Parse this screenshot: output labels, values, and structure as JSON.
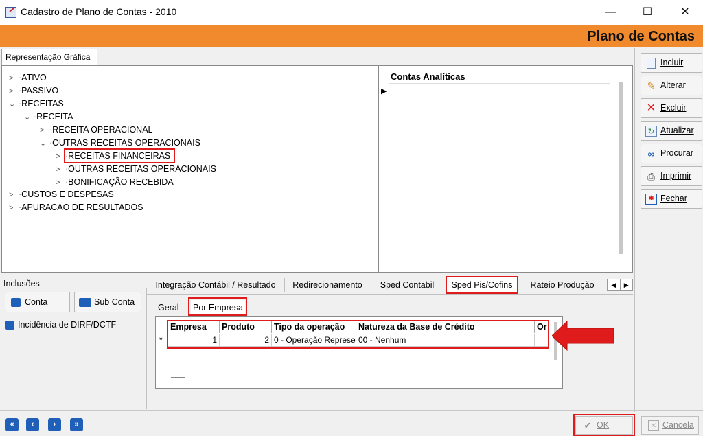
{
  "window": {
    "title": "Cadastro de Plano de Contas - 2010",
    "minimize": "—",
    "maximize": "☐",
    "close": "✕"
  },
  "header": {
    "title": "Plano de Contas"
  },
  "left_tab": {
    "label": "Representação Gráfica"
  },
  "tree": [
    {
      "label": "ATIVO",
      "expanded": false
    },
    {
      "label": "PASSIVO",
      "expanded": false
    },
    {
      "label": "RECEITAS",
      "expanded": true
    },
    {
      "label": "RECEITA",
      "expanded": true
    },
    {
      "label": "RECEITA OPERACIONAL",
      "expanded": false
    },
    {
      "label": "OUTRAS RECEITAS OPERACIONAIS",
      "expanded": true
    },
    {
      "label": "RECEITAS FINANCEIRAS",
      "expanded": false,
      "selected": true
    },
    {
      "label": "OUTRAS RECEITAS OPERACIONAIS",
      "expanded": false
    },
    {
      "label": "BONIFICAÇÃO RECEBIDA",
      "expanded": false
    },
    {
      "label": "CUSTOS E DESPESAS",
      "expanded": false
    },
    {
      "label": "APURACAO DE RESULTADOS",
      "expanded": false
    }
  ],
  "analytic": {
    "header": "Contas Analíticas",
    "row_indicator": "▶"
  },
  "toolbar": {
    "incluir": "Incluir",
    "alterar": "Alterar",
    "excluir": "Excluir",
    "atualizar": "Atualizar",
    "procurar": "Procurar",
    "imprimir": "Imprimir",
    "fechar": "Fechar"
  },
  "inclusoes": {
    "label": "Inclusões",
    "conta": "Conta",
    "sub_conta": "Sub Conta",
    "dirf": "Incidência de DIRF/DCTF"
  },
  "tabs": [
    "Integração Contábil / Resultado",
    "Redirecionamento",
    "Sped Contabil",
    "Sped Pis/Cofins",
    "Rateio Produção"
  ],
  "tab_nav": {
    "prev": "◀",
    "next": "▶"
  },
  "subtabs": [
    "Geral",
    "Por Empresa"
  ],
  "grid": {
    "columns": [
      "Empresa",
      "Produto",
      "Tipo da operação",
      "Natureza da Base de Crédito",
      "Or"
    ],
    "row_marker": "*",
    "rows": [
      [
        "1",
        "2",
        "0 - Operação Represen",
        "00 - Nenhum",
        ""
      ]
    ]
  },
  "bottom": {
    "nav": [
      "«",
      "‹",
      "›",
      "»"
    ],
    "ok": "OK",
    "cancela": "Cancela"
  },
  "colors": {
    "accent": "#f08a2c",
    "highlight": "#e01b1b",
    "nav_blue": "#1f5fb8"
  }
}
